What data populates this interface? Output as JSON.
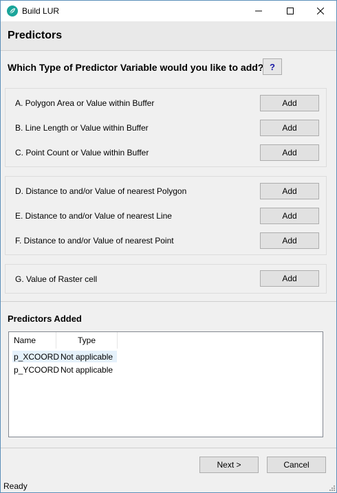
{
  "window": {
    "title": "Build LUR",
    "icon": "app-leaf-icon",
    "controls": [
      "minimize-icon",
      "maximize-icon",
      "close-icon"
    ]
  },
  "header": {
    "title": "Predictors"
  },
  "question": {
    "text": "Which Type of Predictor Variable would you like to add?",
    "help_label": "?"
  },
  "groups": [
    {
      "rows": [
        {
          "label": "A. Polygon Area or Value within Buffer",
          "button": "Add"
        },
        {
          "label": "B. Line Length or Value within Buffer",
          "button": "Add"
        },
        {
          "label": "C. Point Count or Value within Buffer",
          "button": "Add"
        }
      ]
    },
    {
      "rows": [
        {
          "label": "D. Distance to and/or Value of nearest Polygon",
          "button": "Add"
        },
        {
          "label": "E. Distance to and/or Value of nearest Line",
          "button": "Add"
        },
        {
          "label": "F. Distance to and/or Value of nearest Point",
          "button": "Add"
        }
      ]
    },
    {
      "rows": [
        {
          "label": "G. Value of Raster cell",
          "button": "Add"
        }
      ]
    }
  ],
  "predictors_added": {
    "title": "Predictors Added",
    "columns": [
      "Name",
      "Type"
    ],
    "rows": [
      {
        "name": "p_XCOORD",
        "type": "Not applicable",
        "selected": true
      },
      {
        "name": "p_YCOORD",
        "type": "Not applicable",
        "selected": false
      }
    ]
  },
  "footer": {
    "next_label": "Next >",
    "cancel_label": "Cancel"
  },
  "status": {
    "text": "Ready"
  },
  "colors": {
    "accent": "#1aa59a",
    "help_text": "#1a1aa6",
    "selection": "#e5f1fb"
  }
}
